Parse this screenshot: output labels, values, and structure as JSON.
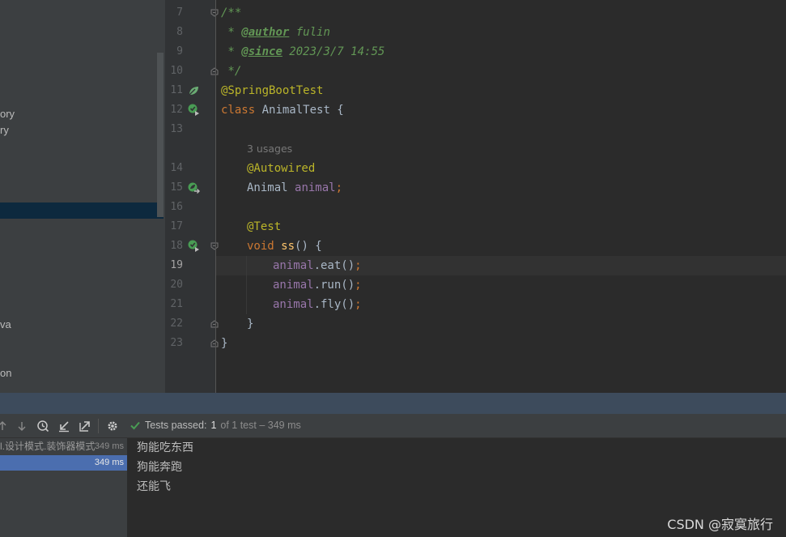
{
  "project_tree": {
    "items": [
      "ory",
      "ry",
      "va",
      "on"
    ]
  },
  "editor": {
    "line_numbers": [
      "7",
      "8",
      "9",
      "10",
      "11",
      "12",
      "13",
      "14",
      "15",
      "16",
      "17",
      "18",
      "19",
      "20",
      "21",
      "22",
      "23"
    ],
    "current_line": "19",
    "code": {
      "l7_comment": "/**",
      "l8_star": " * ",
      "l8_tag": "@author",
      "l8_value": " fulin",
      "l9_star": " * ",
      "l9_tag": "@since",
      "l9_value": " 2023/3/7 14:55",
      "l10_comment": " */",
      "l11_annotation": "@SpringBootTest",
      "l12_keyword": "class",
      "l12_rest": " AnimalTest {",
      "usage_hint": "3 usages",
      "l14_annotation": "@Autowired",
      "l15_type": "Animal ",
      "l15_field": "animal",
      "l15_semi": ";",
      "l17_annotation": "@Test",
      "l18_keyword": "void",
      "l18_space": " ",
      "l18_method": "ss",
      "l18_rest": "() {",
      "l19_field": "animal",
      "l19_call": ".eat()",
      "l19_semi": ";",
      "l20_field": "animal",
      "l20_call": ".run()",
      "l20_semi": ";",
      "l21_field": "animal",
      "l21_call": ".fly()",
      "l21_semi": ";",
      "l22_brace": "}",
      "l23_brace": "}"
    }
  },
  "run_panel": {
    "toolbar": {
      "icons": [
        "arrow-up-icon",
        "arrow-down-icon",
        "history-icon",
        "collapse-icon",
        "expand-icon",
        "gear-icon"
      ]
    },
    "status": {
      "label": "Tests passed:",
      "passed": "1",
      "of_text": "of 1 test – 349 ms"
    },
    "test_tree": [
      {
        "name": "l.设计模式.装饰器模式",
        "time": "349 ms"
      },
      {
        "name": "",
        "time": "349 ms"
      }
    ],
    "console_lines": [
      "狗能吃东西",
      "狗能奔跑",
      "还能飞"
    ]
  },
  "watermark": "CSDN @寂寞旅行",
  "colors": {
    "comment": "#629755",
    "annotation": "#bbb529",
    "keyword": "#cc7832",
    "field": "#9876aa",
    "method": "#ffc66d",
    "test_pass": "#499c54",
    "selection": "#4b6eaf"
  }
}
